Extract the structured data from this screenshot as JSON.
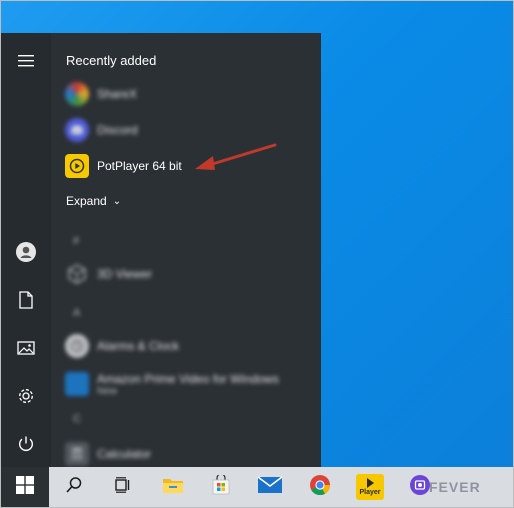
{
  "start_menu": {
    "section_title": "Recently added",
    "apps_recent": [
      {
        "label": "ShareX",
        "icon": "sharex-icon",
        "blurred": true
      },
      {
        "label": "Discord",
        "icon": "discord-icon",
        "blurred": true
      },
      {
        "label": "PotPlayer 64 bit",
        "icon": "potplayer-icon",
        "blurred": false
      }
    ],
    "expand_label": "Expand",
    "letters": [
      "#",
      "A",
      "C"
    ],
    "apps_all": [
      {
        "label": "3D Viewer",
        "icon": "3d-viewer-icon"
      },
      {
        "label": "Alarms & Clock",
        "icon": "alarm-clock-icon"
      },
      {
        "label": "Amazon Prime Video for Windows",
        "sub": "New",
        "icon": "prime-video-icon"
      },
      {
        "label": "Calculator",
        "icon": "calculator-icon"
      }
    ],
    "rail": [
      "menu-icon",
      "user-icon",
      "documents-icon",
      "pictures-icon",
      "settings-icon",
      "power-icon"
    ]
  },
  "taskbar": {
    "items": [
      "windows-start-icon",
      "search-icon",
      "task-view-icon",
      "file-explorer-icon",
      "store-icon",
      "mail-icon",
      "chrome-icon",
      "potplayer-icon",
      "extra-app-icon"
    ],
    "potplayer_badge": "Player"
  },
  "watermark": "FEVER",
  "colors": {
    "arrow": "#c0392b",
    "potplayer": "#f5c800"
  }
}
